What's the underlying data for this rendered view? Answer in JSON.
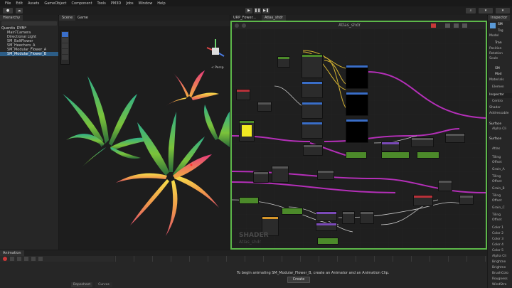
{
  "menu": [
    "File",
    "Edit",
    "Assets",
    "GameObject",
    "Component",
    "Tools",
    "PM3D",
    "Jobs",
    "Window",
    "Help"
  ],
  "hierarchy": {
    "tab": "Hierarchy",
    "items": [
      "Quentis_DYM*",
      "Main Camera",
      "Directional Light",
      "SM_BaltFlower",
      "SM_Heechers_A",
      "SM_Modular_Flower_A",
      "SM_Modular_Flower_B"
    ]
  },
  "scene": {
    "tabs": [
      "Scene",
      "Game"
    ],
    "persp_label": "< Persp"
  },
  "shader_graph": {
    "tabs": [
      "URP_Fower...",
      "Atlas_shdr"
    ],
    "title": "Atlas_shdr",
    "watermark_top": "SHADER",
    "watermark_bottom": "Atlas_shdr"
  },
  "inspector": {
    "tab": "Inspector",
    "header_name": "SM",
    "rows": [
      "Tag",
      "Model",
      "Tran",
      "Position",
      "Rotation",
      "Scale",
      "SM",
      "Mod",
      "Materials",
      "Elemen"
    ],
    "sub_tab": "Inspector",
    "sub_rows": [
      "Centro",
      "Shader",
      "Addressable",
      "Surface",
      "Alpha Cli",
      "Surface",
      "Atlas",
      "Tiling",
      "Offset",
      "Grain_A",
      "Tiling",
      "Offset",
      "Grain_B",
      "Tiling",
      "Offset",
      "Grain_C",
      "Tiling",
      "Offset",
      "Color 1",
      "Color 2",
      "Color 3",
      "Color 4",
      "Color 5",
      "Alpha Cli",
      "Brightne",
      "Brightne",
      "BrushColo",
      "Rougness",
      "WindStre"
    ]
  },
  "animation": {
    "tab": "Animation",
    "message": "To begin animating SM_Modular_Flower_B, create an Animator and an Animation Clip.",
    "create_button": "Create",
    "bottom_tabs": [
      "Dopesheet",
      "Curves"
    ]
  },
  "colors": {
    "graph_border": "#5db84a",
    "graph_bg": "#1f1f1f",
    "wire_magenta": "#b42fb8",
    "wire_yellow": "#d6b431",
    "node_green": "#4c8a2a",
    "node_blue": "#3a6ec8",
    "node_red": "#b8313a",
    "node_purple": "#7b4ab8"
  }
}
